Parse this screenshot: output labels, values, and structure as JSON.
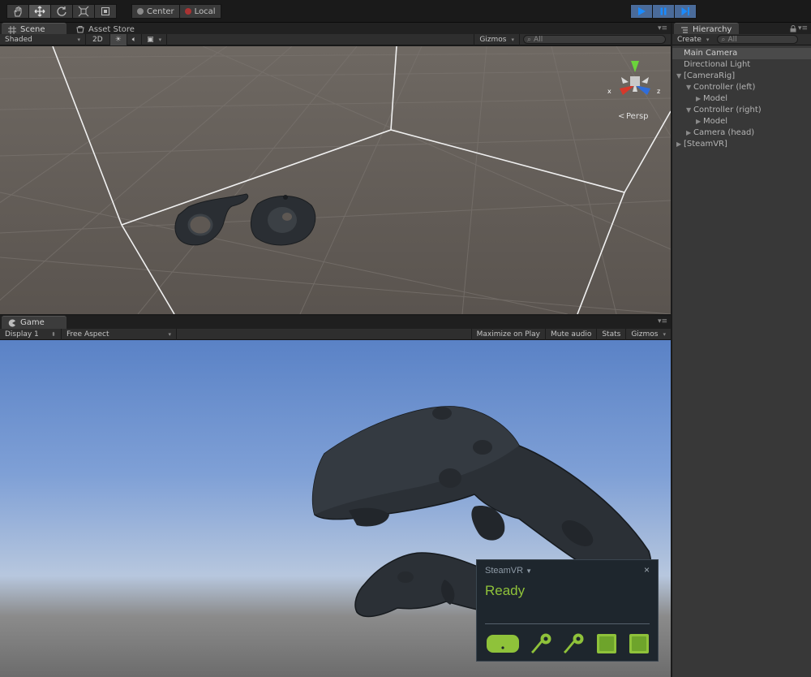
{
  "colors": {
    "accent_play": "#4a6b9a",
    "steamvr_green": "#8fc23a",
    "panel_bg": "#383838",
    "scene_ground": "#5e5853"
  },
  "toolbar": {
    "tools": [
      {
        "name": "hand-icon"
      },
      {
        "name": "move-icon"
      },
      {
        "name": "rotate-icon"
      },
      {
        "name": "scale-icon"
      },
      {
        "name": "rect-icon"
      }
    ],
    "pivot_mode": "Center",
    "pivot_rotation": "Local"
  },
  "scene": {
    "tabs": [
      "Scene",
      "Asset Store"
    ],
    "shading_mode": "Shaded",
    "mode_2d": "2D",
    "gizmos": "Gizmos",
    "search_placeholder": "All",
    "projection": "Persp",
    "axis_x": "x",
    "axis_z": "z"
  },
  "game": {
    "tab": "Game",
    "display": "Display 1",
    "aspect": "Free Aspect",
    "buttons": [
      "Maximize on Play",
      "Mute audio",
      "Stats",
      "Gizmos"
    ]
  },
  "hierarchy": {
    "title": "Hierarchy",
    "create": "Create",
    "search_placeholder": "All",
    "items": [
      {
        "label": "Main Camera",
        "depth": 0,
        "arrow": "",
        "selected": true
      },
      {
        "label": "Directional Light",
        "depth": 0,
        "arrow": ""
      },
      {
        "label": "[CameraRig]",
        "depth": 0,
        "arrow": "down"
      },
      {
        "label": "Controller (left)",
        "depth": 1,
        "arrow": "down"
      },
      {
        "label": "Model",
        "depth": 2,
        "arrow": "right"
      },
      {
        "label": "Controller (right)",
        "depth": 1,
        "arrow": "down"
      },
      {
        "label": "Model",
        "depth": 2,
        "arrow": "right"
      },
      {
        "label": "Camera (head)",
        "depth": 1,
        "arrow": "right"
      },
      {
        "label": "[SteamVR]",
        "depth": 0,
        "arrow": "right"
      }
    ]
  },
  "steamvr": {
    "title": "SteamVR",
    "close": "×",
    "status": "Ready",
    "devices": [
      "headset-icon",
      "controller-icon",
      "controller-icon",
      "base-station-icon",
      "base-station-icon"
    ]
  }
}
